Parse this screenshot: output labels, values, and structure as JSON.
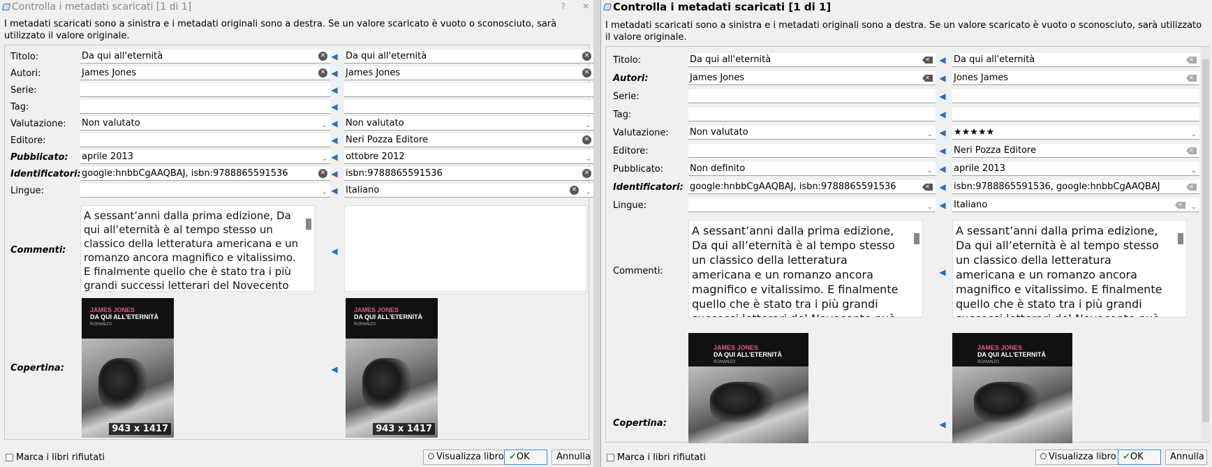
{
  "left": {
    "title": "Controlla i metadati scaricati [1 di 1]",
    "help": "?",
    "close": "✕",
    "description": "I metadati scaricati sono a sinistra e i metadati originali sono a destra. Se un valore scaricato è vuoto o sconosciuto, sarà utilizzato il valore originale.",
    "labels": {
      "title": "Titolo:",
      "authors": "Autori:",
      "series": "Serie:",
      "tags": "Tag:",
      "rating": "Valutazione:",
      "publisher": "Editore:",
      "published": "Pubblicato:",
      "identifiers": "Identificatori:",
      "languages": "Lingue:",
      "comments": "Commenti:",
      "cover": "Copertina:"
    },
    "downloaded": {
      "title": "Da qui all'eternità",
      "authors": "James Jones",
      "series": "",
      "tags": "",
      "rating": "Non valutato",
      "publisher": "",
      "published": "aprile 2013",
      "identifiers": "google:hnbbCgAAQBAJ, isbn:9788865591536",
      "languages": ""
    },
    "original": {
      "title": "Da qui all'eternità",
      "authors": "James Jones",
      "series": "",
      "tags": "",
      "rating": "Non valutato",
      "publisher": "Neri Pozza Editore",
      "published": "ottobre 2012",
      "identifiers": "isbn:9788865591536",
      "languages": "Italiano"
    },
    "comments_downloaded": "A sessant’anni dalla prima edizione, Da qui all’eternità è al tempo stesso un classico della letteratura americana e un romanzo ancora magnifico e vitalissimo. E finalmente quello che è stato tra i più grandi successi letterari del Novecento può essere letto in versione integrale, senza le censure che lo avevano",
    "comments_original": "",
    "cover_downloaded": {
      "author": "JAMES JONES",
      "title": "DA QUI ALL'ETERNITÀ",
      "subtitle": "ROMANZO",
      "size": "943 x 1417"
    },
    "cover_original": {
      "author": "JAMES JONES",
      "title": "DA QUI ALL'ETERNITÀ",
      "subtitle": "ROMANZO",
      "size": "943 x 1417"
    },
    "footer": {
      "mark_rejected": "Marca i libri rifiutati",
      "view_book": "Visualizza libro",
      "ok": "OK",
      "cancel": "Annulla"
    }
  },
  "right": {
    "title": "Controlla i metadati scaricati [1 di 1]",
    "description": "I metadati scaricati sono a sinistra e i metadati originali sono a destra. Se un valore scaricato è vuoto o sconosciuto, sarà utilizzato il valore originale.",
    "labels": {
      "title": "Titolo:",
      "authors": "Autori:",
      "series": "Serie:",
      "tags": "Tag:",
      "rating": "Valutazione:",
      "publisher": "Editore:",
      "published": "Pubblicato:",
      "identifiers": "Identificatori:",
      "languages": "Lingue:",
      "comments": "Commenti:",
      "cover": "Copertina:"
    },
    "downloaded": {
      "title": "Da qui all'eternità",
      "authors": "James Jones",
      "series": "",
      "tags": "",
      "rating": "Non valutato",
      "publisher": "",
      "published": "Non definito",
      "identifiers": "google:hnbbCgAAQBAJ, isbn:9788865591536",
      "languages": ""
    },
    "original": {
      "title": "Da qui all'eternità",
      "authors": "Jones James",
      "series": "",
      "tags": "",
      "rating": "★★★★★",
      "publisher": "Neri Pozza Editore",
      "published": "aprile 2013",
      "identifiers": "isbn:9788865591536, google:hnbbCgAAQBAJ",
      "languages": "Italiano"
    },
    "comments_downloaded": "A sessant’anni dalla prima edizione, Da qui all’eternità è al tempo stesso un classico della letteratura americana e un romanzo ancora magnifico e vitalissimo. E finalmente quello che è stato tra i più grandi successi letterari del Novecento può essere letto in versione integrale, senza le censure che lo avevano martoriato",
    "comments_original": "A sessant’anni dalla prima edizione, Da qui all’eternità è al tempo stesso un classico della letteratura americana e un romanzo ancora magnifico e vitalissimo. E finalmente quello che è stato tra i più grandi successi letterari del Novecento può essere letto in versione integrale, senza le censure che lo avevano martoriato",
    "cover_downloaded": {
      "author": "JAMES JONES",
      "title": "DA QUI ALL'ETERNITÀ",
      "subtitle": "ROMANZO"
    },
    "cover_original": {
      "author": "JAMES JONES",
      "title": "DA QUI ALL'ETERNITÀ",
      "subtitle": "ROMANZO"
    },
    "footer": {
      "mark_rejected": "Marca i libri rifiutati",
      "view_book": "Visualizza libro",
      "ok": "OK",
      "cancel": "Annulla"
    }
  },
  "icons": {
    "copy": "arrow-left-icon",
    "clear": "clear-icon",
    "dropdown": "chevron-down-icon",
    "ok": "checkmark-icon",
    "view": "magnifier-icon"
  }
}
